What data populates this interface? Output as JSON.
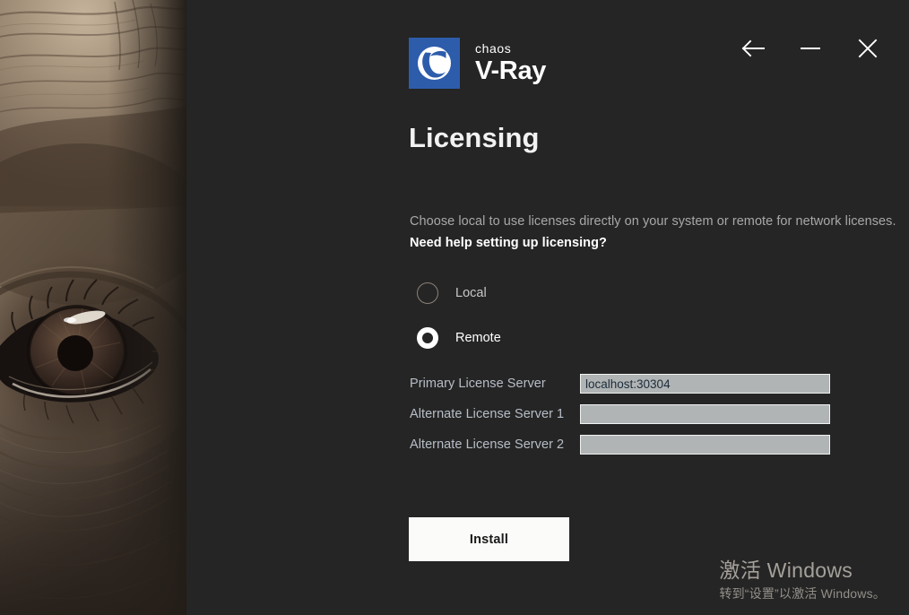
{
  "window": {
    "controls": [
      {
        "name": "back-button",
        "icon": "arrow-left-icon",
        "label": "Back"
      },
      {
        "name": "minimize-button",
        "icon": "minimize-icon",
        "label": "Minimize"
      },
      {
        "name": "close-button",
        "icon": "close-icon",
        "label": "Close"
      }
    ]
  },
  "brand": {
    "company": "chaos",
    "product": "V-Ray",
    "logo_bg": "#2d5cab",
    "logo_icon": "vray-logo-icon"
  },
  "page": {
    "title": "Licensing",
    "description": "Choose local to use licenses directly on your system or remote for network licenses.",
    "help_link": "Need help setting up licensing?"
  },
  "license_mode": {
    "selected": "remote",
    "options": [
      {
        "id": "local",
        "label": "Local",
        "selected": false
      },
      {
        "id": "remote",
        "label": "Remote",
        "selected": true
      }
    ]
  },
  "servers": {
    "fields": [
      {
        "id": "primary",
        "label": "Primary License Server",
        "value": "localhost:30304",
        "placeholder": ""
      },
      {
        "id": "alternate1",
        "label": "Alternate License Server 1",
        "value": "",
        "placeholder": ""
      },
      {
        "id": "alternate2",
        "label": "Alternate License Server 2",
        "value": "",
        "placeholder": ""
      }
    ]
  },
  "actions": {
    "install_label": "Install"
  },
  "activation": {
    "title": "激活 Windows",
    "subtitle": "转到“设置”以激活 Windows。"
  },
  "colors": {
    "panel_bg": "#252525",
    "accent_blue": "#2d5cab",
    "input_bg": "#b0b4b4",
    "button_bg": "#fbfbf9",
    "label_text": "#b7bec7"
  }
}
